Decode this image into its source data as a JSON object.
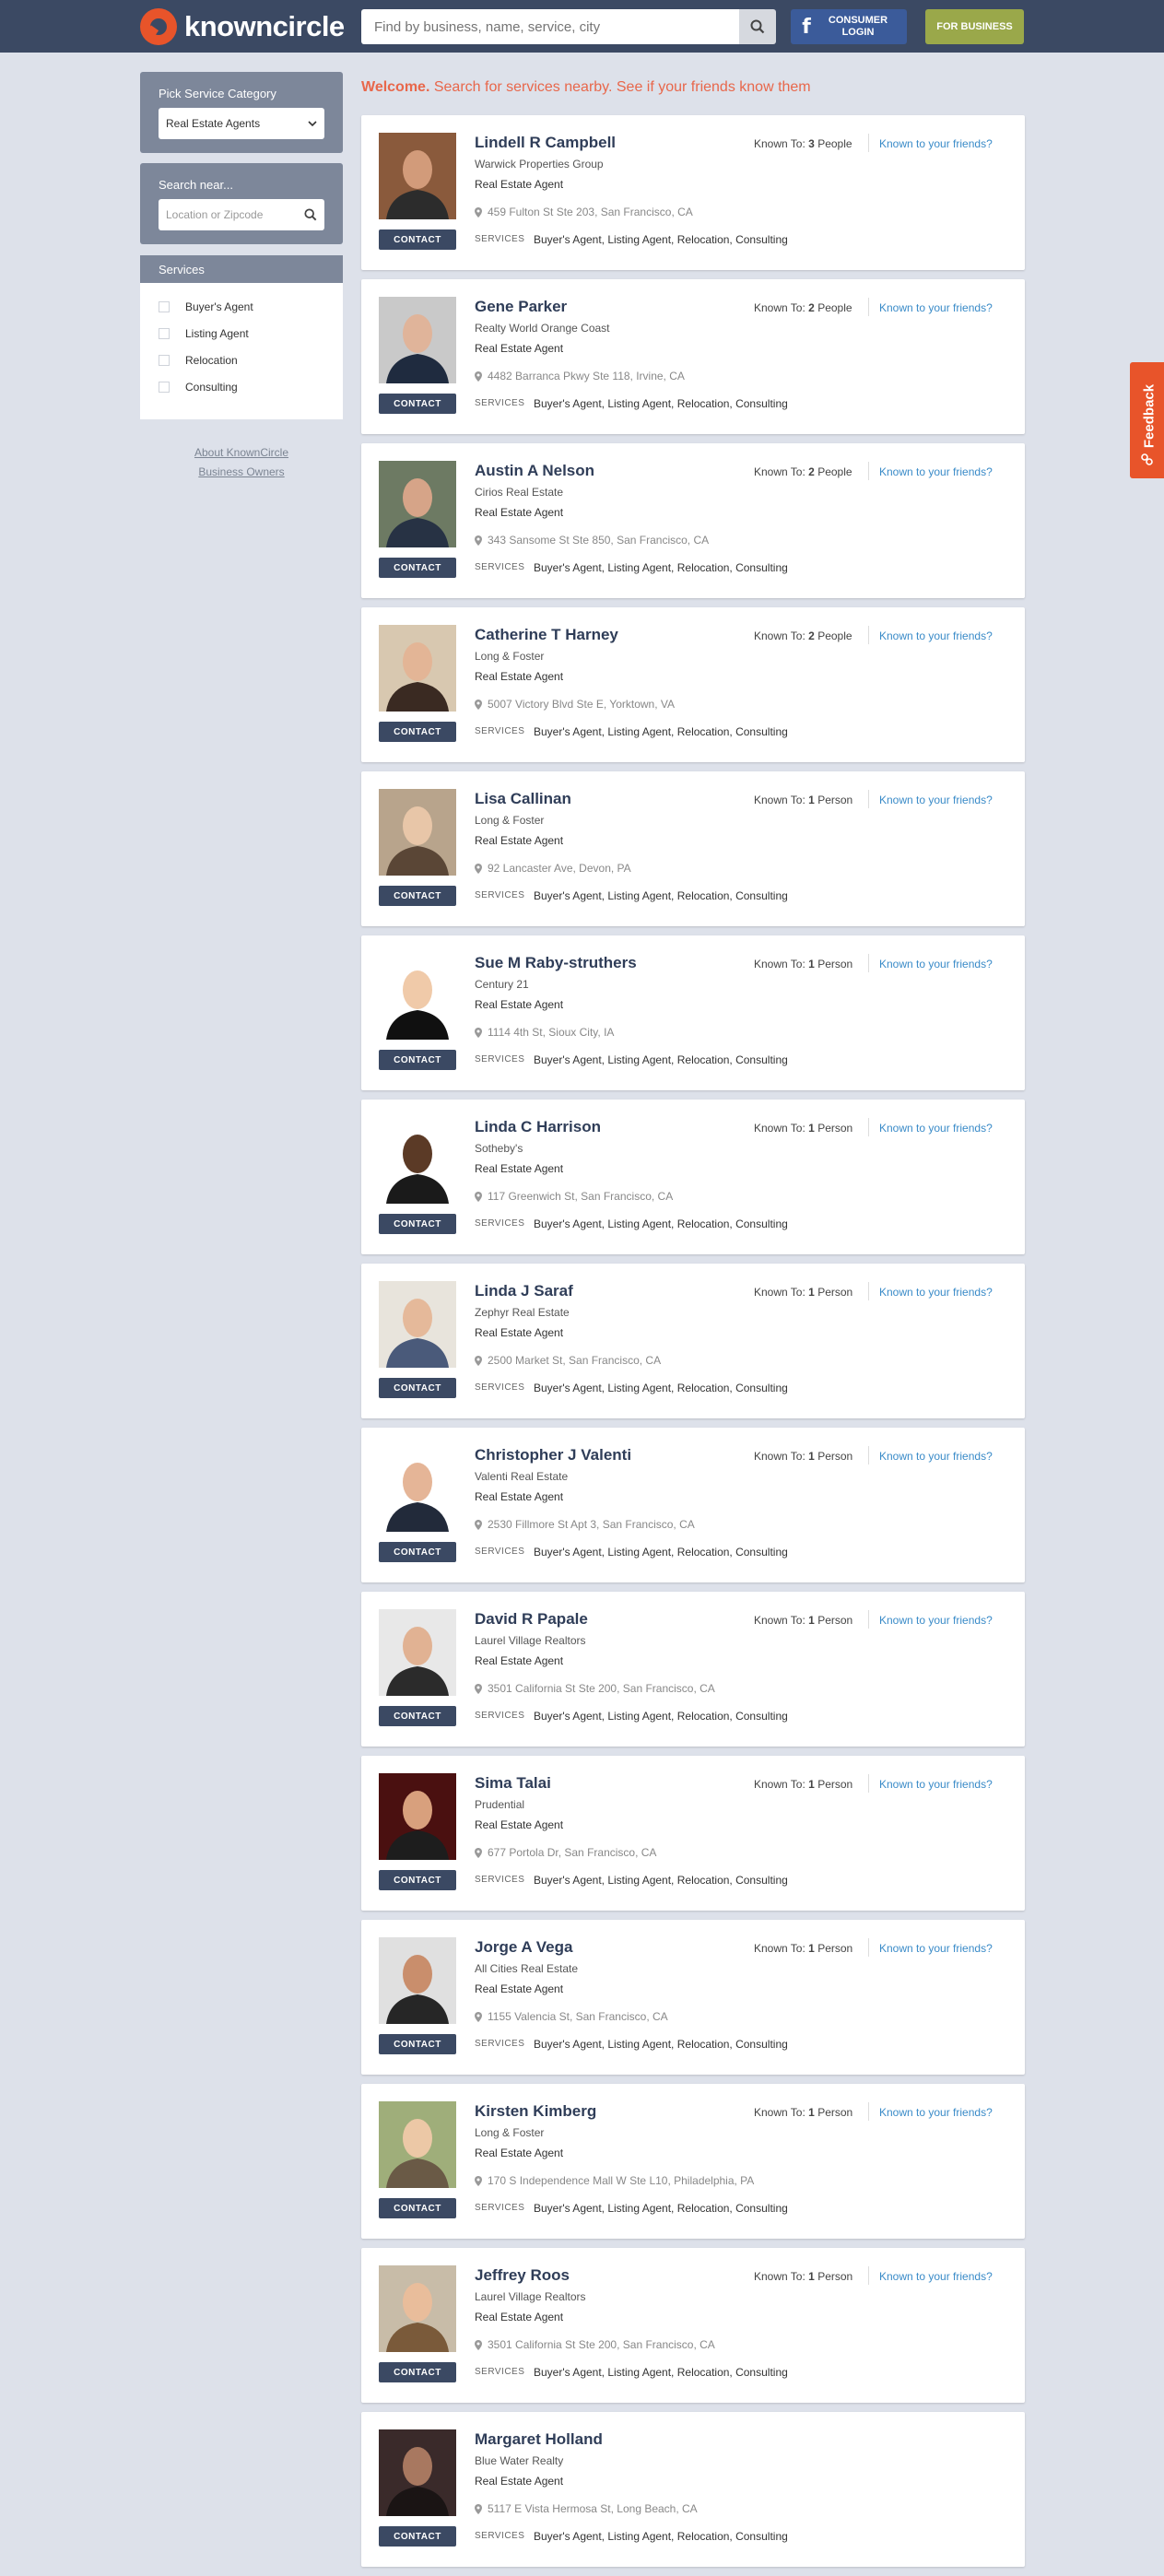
{
  "header": {
    "logo_text": "knowncircle",
    "search_placeholder": "Find by business, name, service, city",
    "consumer_login": "CONSUMER LOGIN",
    "fb_letter": "f",
    "for_business": "FOR BUSINESS"
  },
  "sidebar": {
    "category_title": "Pick Service Category",
    "category_value": "Real Estate Agents",
    "search_near_title": "Search near...",
    "location_placeholder": "Location or Zipcode",
    "services_title": "Services",
    "services": [
      "Buyer's Agent",
      "Listing Agent",
      "Relocation",
      "Consulting"
    ],
    "about_link": "About KnownCircle",
    "business_link": "Business Owners"
  },
  "welcome": {
    "bold": "Welcome.",
    "text": "Search for services nearby. See if your friends know them"
  },
  "card_labels": {
    "contact": "CONTACT",
    "services": "SERVICES",
    "known_to": "Known To:",
    "known_link": "Known to your friends?"
  },
  "feedback": "Feedback",
  "listings": [
    {
      "name": "Lindell R Campbell",
      "company": "Warwick Properties Group",
      "role": "Real Estate Agent",
      "address": "459 Fulton St Ste 203, San Francisco, CA",
      "services": "Buyer's Agent, Listing Agent, Relocation, Consulting",
      "known_count": "3",
      "known_unit": "People"
    },
    {
      "name": "Gene Parker",
      "company": "Realty World Orange Coast",
      "role": "Real Estate Agent",
      "address": "4482 Barranca Pkwy Ste 118, Irvine, CA",
      "services": "Buyer's Agent, Listing Agent, Relocation, Consulting",
      "known_count": "2",
      "known_unit": "People"
    },
    {
      "name": "Austin A Nelson",
      "company": "Cirios Real Estate",
      "role": "Real Estate Agent",
      "address": "343 Sansome St Ste 850, San Francisco, CA",
      "services": "Buyer's Agent, Listing Agent, Relocation, Consulting",
      "known_count": "2",
      "known_unit": "People"
    },
    {
      "name": "Catherine T Harney",
      "company": "Long & Foster",
      "role": "Real Estate Agent",
      "address": "5007 Victory Blvd Ste E, Yorktown, VA",
      "services": "Buyer's Agent, Listing Agent, Relocation, Consulting",
      "known_count": "2",
      "known_unit": "People"
    },
    {
      "name": "Lisa Callinan",
      "company": "Long & Foster",
      "role": "Real Estate Agent",
      "address": "92 Lancaster Ave, Devon, PA",
      "services": "Buyer's Agent, Listing Agent, Relocation, Consulting",
      "known_count": "1",
      "known_unit": "Person"
    },
    {
      "name": "Sue M Raby-struthers",
      "company": "Century 21",
      "role": "Real Estate Agent",
      "address": "1114 4th St, Sioux City, IA",
      "services": "Buyer's Agent, Listing Agent, Relocation, Consulting",
      "known_count": "1",
      "known_unit": "Person"
    },
    {
      "name": "Linda C Harrison",
      "company": "Sotheby's",
      "role": "Real Estate Agent",
      "address": "117 Greenwich St, San Francisco, CA",
      "services": "Buyer's Agent, Listing Agent, Relocation, Consulting",
      "known_count": "1",
      "known_unit": "Person"
    },
    {
      "name": "Linda J Saraf",
      "company": "Zephyr Real Estate",
      "role": "Real Estate Agent",
      "address": "2500 Market St, San Francisco, CA",
      "services": "Buyer's Agent, Listing Agent, Relocation, Consulting",
      "known_count": "1",
      "known_unit": "Person"
    },
    {
      "name": "Christopher J Valenti",
      "company": "Valenti Real Estate",
      "role": "Real Estate Agent",
      "address": "2530 Fillmore St Apt 3, San Francisco, CA",
      "services": "Buyer's Agent, Listing Agent, Relocation, Consulting",
      "known_count": "1",
      "known_unit": "Person"
    },
    {
      "name": "David R Papale",
      "company": "Laurel Village Realtors",
      "role": "Real Estate Agent",
      "address": "3501 California St Ste 200, San Francisco, CA",
      "services": "Buyer's Agent, Listing Agent, Relocation, Consulting",
      "known_count": "1",
      "known_unit": "Person"
    },
    {
      "name": "Sima Talai",
      "company": "Prudential",
      "role": "Real Estate Agent",
      "address": "677 Portola Dr, San Francisco, CA",
      "services": "Buyer's Agent, Listing Agent, Relocation, Consulting",
      "known_count": "1",
      "known_unit": "Person"
    },
    {
      "name": "Jorge A Vega",
      "company": "All Cities Real Estate",
      "role": "Real Estate Agent",
      "address": "1155 Valencia St, San Francisco, CA",
      "services": "Buyer's Agent, Listing Agent, Relocation, Consulting",
      "known_count": "1",
      "known_unit": "Person"
    },
    {
      "name": "Kirsten Kimberg",
      "company": "Long & Foster",
      "role": "Real Estate Agent",
      "address": "170 S Independence Mall W Ste L10, Philadelphia, PA",
      "services": "Buyer's Agent, Listing Agent, Relocation, Consulting",
      "known_count": "1",
      "known_unit": "Person"
    },
    {
      "name": "Jeffrey Roos",
      "company": "Laurel Village Realtors",
      "role": "Real Estate Agent",
      "address": "3501 California St Ste 200, San Francisco, CA",
      "services": "Buyer's Agent, Listing Agent, Relocation, Consulting",
      "known_count": "1",
      "known_unit": "Person"
    },
    {
      "name": "Margaret Holland",
      "company": "Blue Water Realty",
      "role": "Real Estate Agent",
      "address": "5117 E Vista Hermosa St, Long Beach, CA",
      "services": "Buyer's Agent, Listing Agent, Relocation, Consulting",
      "known_count": "",
      "known_unit": ""
    }
  ],
  "colors": {
    "header_bg": "#3b4963",
    "accent_orange": "#e8542a",
    "facebook": "#3b5b9a",
    "business_green": "#9aa84a",
    "link_blue": "#3a8bc8",
    "page_bg": "#dde1ea"
  }
}
